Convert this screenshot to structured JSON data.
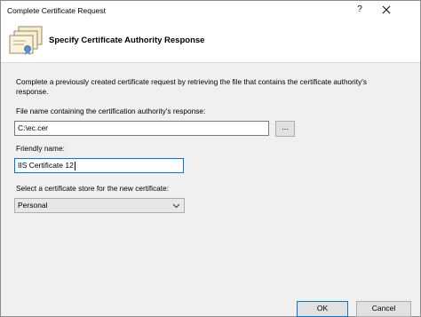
{
  "window": {
    "title": "Complete Certificate Request",
    "help_glyph": "?",
    "close_icon": "close-icon"
  },
  "header": {
    "heading": "Specify Certificate Authority Response",
    "icon": "certificate-icon"
  },
  "content": {
    "description": "Complete a previously created certificate request by retrieving the file that contains the certificate authority's response.",
    "filename_label": "File name containing the certification authority's response:",
    "filename_value": "C:\\ec.cer",
    "browse_label": "...",
    "friendly_label": "Friendly name:",
    "friendly_value": "IIS Certificate 12",
    "store_label": "Select a certificate store for the new certificate:",
    "store_value": "Personal"
  },
  "footer": {
    "ok_label": "OK",
    "cancel_label": "Cancel"
  },
  "colors": {
    "accent": "#0078d7",
    "window_bg": "#f0f0f0",
    "header_bg": "#ffffff"
  }
}
